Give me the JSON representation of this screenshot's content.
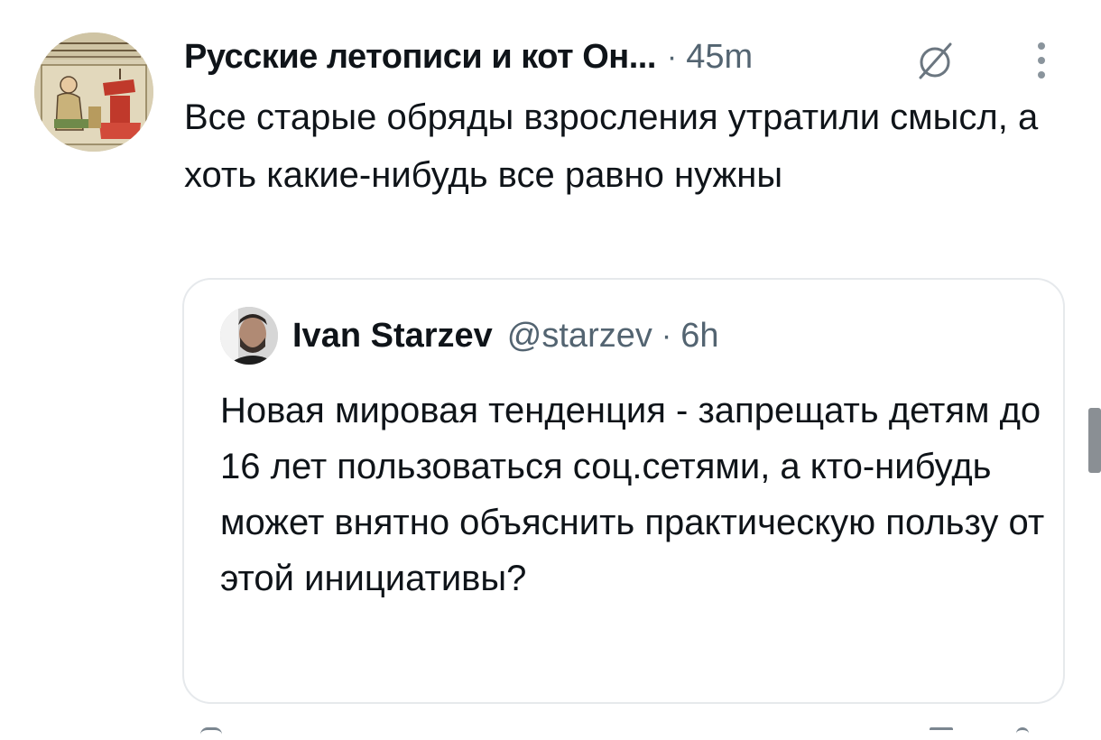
{
  "post": {
    "author_name": "Русские летописи и кот Он...",
    "separator": "·",
    "time": "45m",
    "text": "Все старые обряды взросления утратили смысл, а хоть какие-нибудь все равно нужны",
    "avatar_icon": "illuminated-manuscript-avatar",
    "grok_icon": "grok-slash-icon",
    "more_icon": "vertical-ellipsis-icon"
  },
  "quoted": {
    "name": "Ivan Starzev",
    "handle": "@starzev",
    "separator": "·",
    "time": "6h",
    "text": "Новая мировая тенденция - запрещать детям до 16 лет пользоваться соц.сетями, а кто-нибудь может внятно объяснить практическую пользу от этой инициативы?",
    "avatar_icon": "person-photo-avatar"
  },
  "colors": {
    "text_primary": "#0f1419",
    "text_secondary": "#536471",
    "border": "#e6e9ec",
    "background": "#ffffff"
  }
}
